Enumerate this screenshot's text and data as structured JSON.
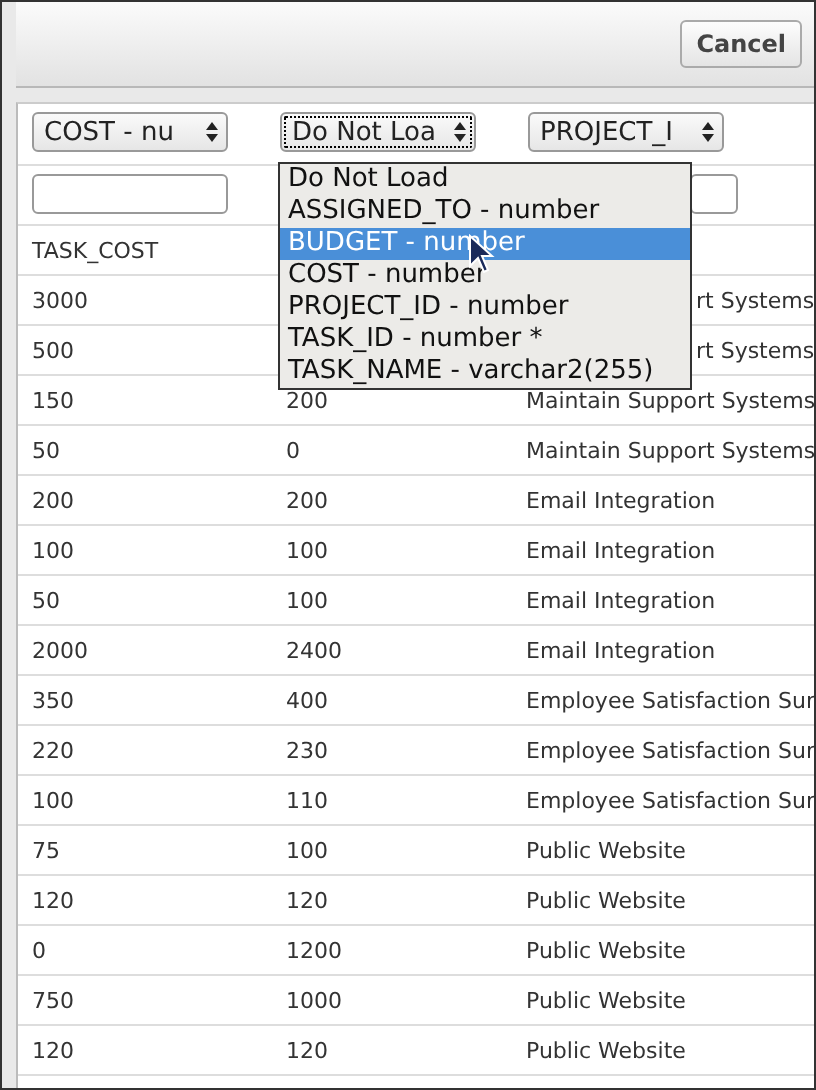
{
  "toolbar": {
    "cancel_button": "Cancel"
  },
  "column_selects": [
    {
      "value": "COST - nu",
      "focused": false
    },
    {
      "value": "Do Not Loa",
      "focused": true
    },
    {
      "value": "PROJECT_I",
      "focused": false
    }
  ],
  "dropdown": {
    "options": [
      {
        "label": "Do Not Load",
        "selected": false
      },
      {
        "label": "ASSIGNED_TO - number",
        "selected": false
      },
      {
        "label": "BUDGET - number",
        "selected": true
      },
      {
        "label": "COST - number",
        "selected": false
      },
      {
        "label": "PROJECT_ID - number",
        "selected": false
      },
      {
        "label": "TASK_ID - number *",
        "selected": false
      },
      {
        "label": "TASK_NAME - varchar2(255)",
        "selected": false
      }
    ]
  },
  "table": {
    "header": [
      "TASK_COST"
    ],
    "rows": [
      {
        "cells": [
          "3000"
        ],
        "column_3_tail": "rt Systems"
      },
      {
        "cells": [
          "500"
        ],
        "column_3_tail": "rt Systems"
      },
      {
        "cells": [
          "150",
          "200",
          "Maintain Support Systems"
        ]
      },
      {
        "cells": [
          "50",
          "0",
          "Maintain Support Systems"
        ]
      },
      {
        "cells": [
          "200",
          "200",
          "Email Integration"
        ]
      },
      {
        "cells": [
          "100",
          "100",
          "Email Integration"
        ]
      },
      {
        "cells": [
          "50",
          "100",
          "Email Integration"
        ]
      },
      {
        "cells": [
          "2000",
          "2400",
          "Email Integration"
        ]
      },
      {
        "cells": [
          "350",
          "400",
          "Employee Satisfaction Sur"
        ]
      },
      {
        "cells": [
          "220",
          "230",
          "Employee Satisfaction Sur"
        ]
      },
      {
        "cells": [
          "100",
          "110",
          "Employee Satisfaction Sur"
        ]
      },
      {
        "cells": [
          "75",
          "100",
          "Public Website"
        ]
      },
      {
        "cells": [
          "120",
          "120",
          "Public Website"
        ]
      },
      {
        "cells": [
          "0",
          "1200",
          "Public Website"
        ]
      },
      {
        "cells": [
          "750",
          "1000",
          "Public Website"
        ]
      },
      {
        "cells": [
          "120",
          "120",
          "Public Website"
        ]
      }
    ]
  }
}
